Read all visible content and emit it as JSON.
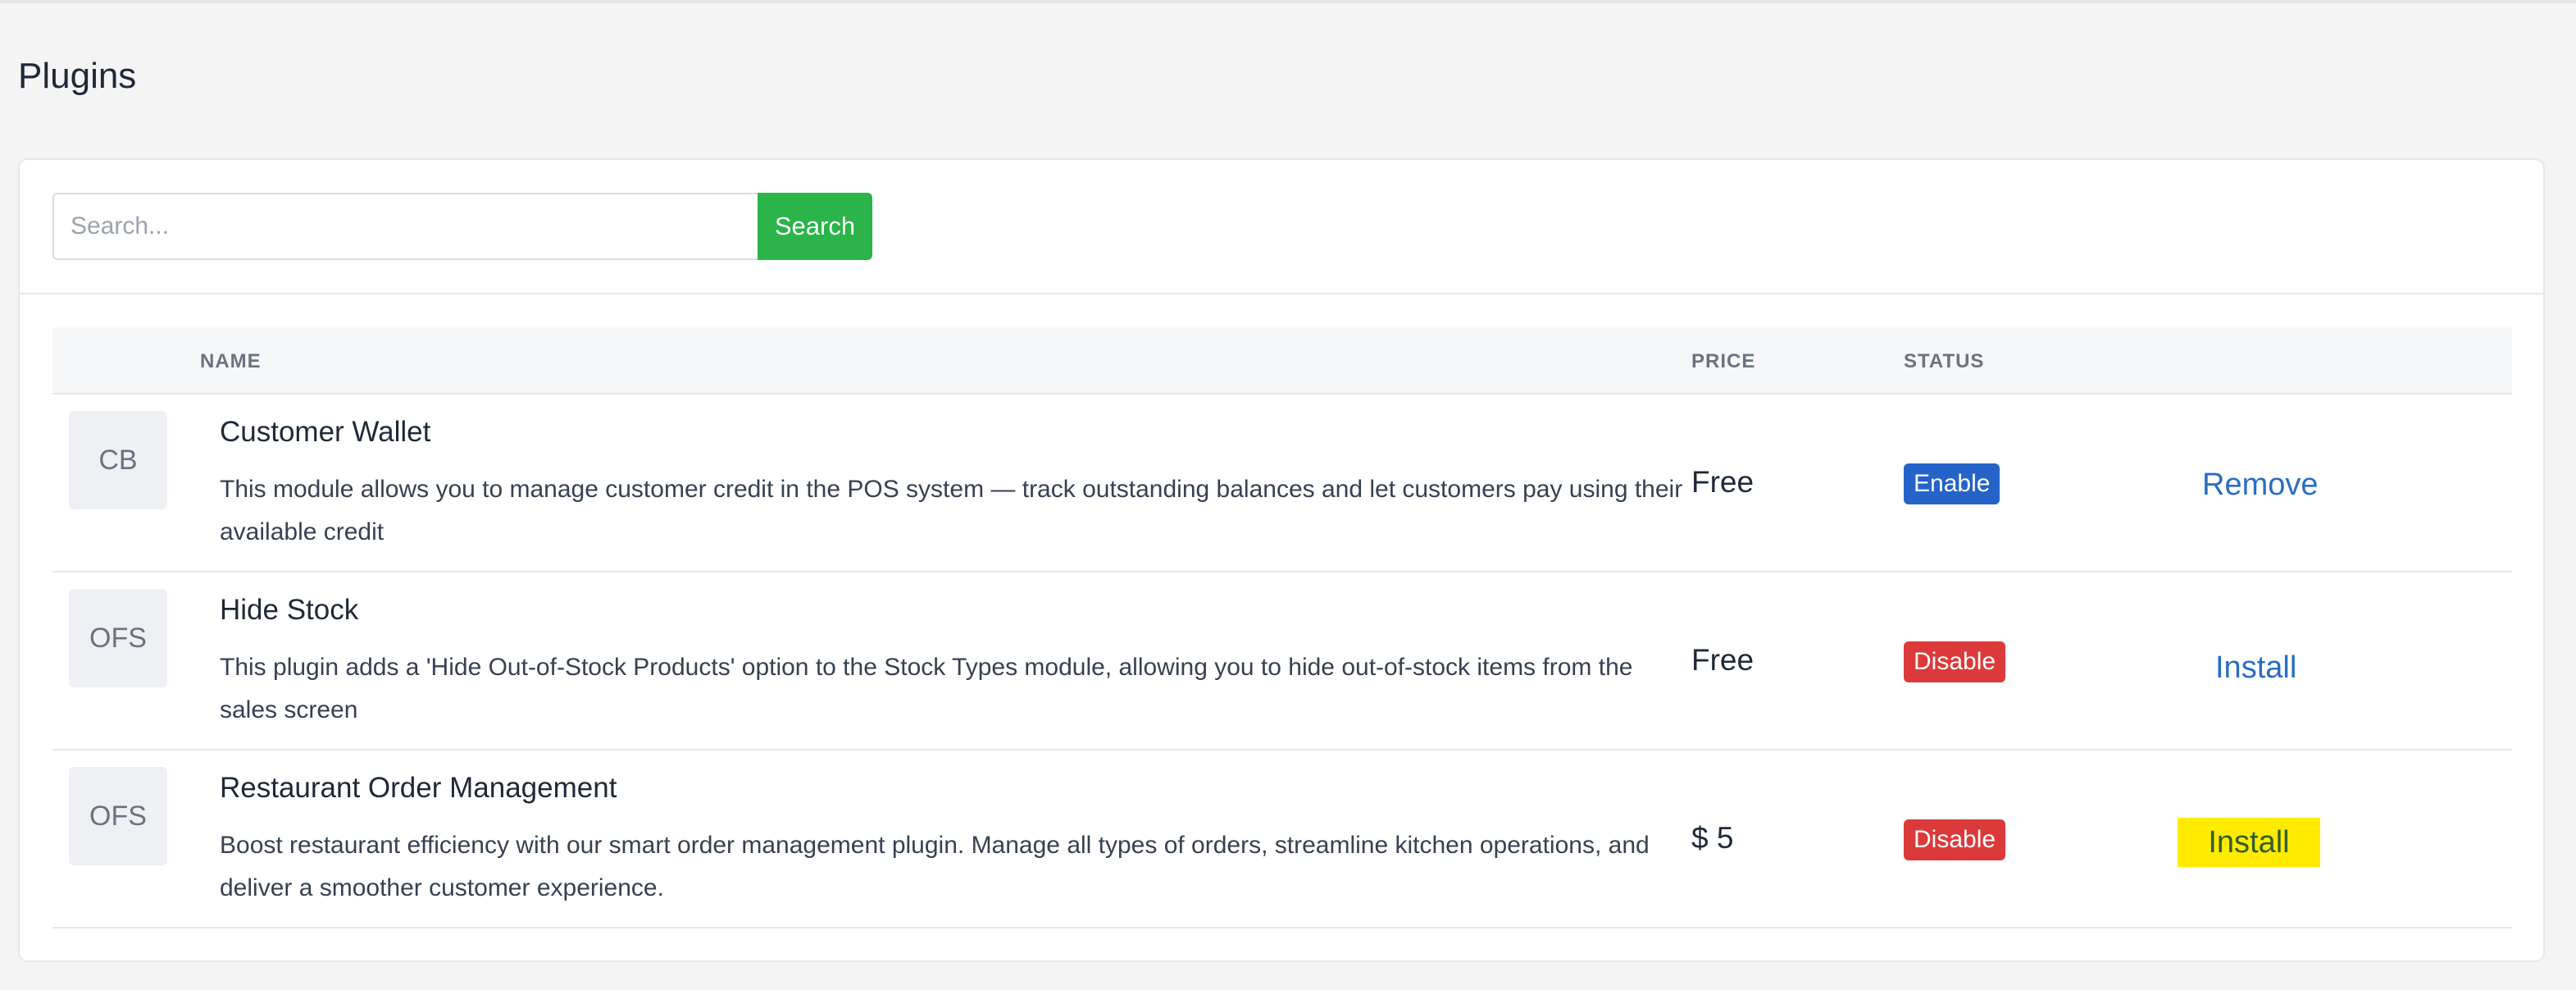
{
  "page": {
    "title": "Plugins"
  },
  "search": {
    "placeholder": "Search...",
    "value": "",
    "button_label": "Search"
  },
  "table": {
    "headers": {
      "name": "NAME",
      "price": "PRICE",
      "status": "STATUS"
    },
    "rows": [
      {
        "thumb": "CB",
        "name": "Customer Wallet",
        "description": "This module allows you to manage customer credit in the POS system — track outstanding balances and let customers pay using their available credit",
        "price": "Free",
        "status": "Enable",
        "action": "Remove"
      },
      {
        "thumb": "OFS",
        "name": "Hide Stock",
        "description": "This plugin adds a 'Hide Out-of-Stock Products' option to the Stock Types module, allowing you to hide out-of-stock items from the sales screen",
        "price": "Free",
        "status": "Disable",
        "action": "Install"
      },
      {
        "thumb": "OFS",
        "name": "Restaurant Order Management",
        "description": "Boost restaurant efficiency with our smart order management plugin. Manage all types of orders, streamline kitchen operations, and deliver a smoother customer experience.",
        "price": "$ 5",
        "status": "Disable",
        "action": "Install"
      }
    ]
  },
  "colors": {
    "search_button": "#2ab44a",
    "enable_badge": "#2563c9",
    "disable_badge": "#dc3a3a",
    "link": "#2a6dc4",
    "highlight": "#ffeb00"
  }
}
